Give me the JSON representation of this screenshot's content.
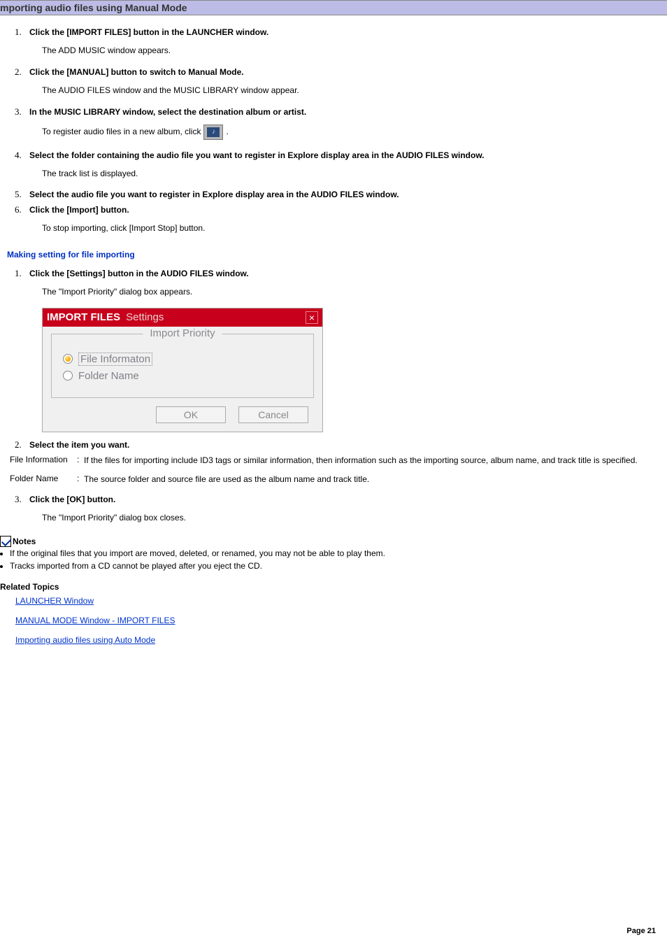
{
  "titleBar": "mporting audio files using Manual Mode",
  "steps": [
    {
      "label": "Click the [IMPORT FILES] button in the LAUNCHER window.",
      "desc": "The ADD MUSIC window appears."
    },
    {
      "label": "Click the [MANUAL] button to switch to Manual Mode.",
      "desc": "The AUDIO FILES window and the MUSIC LIBRARY window appear."
    },
    {
      "label": "In the MUSIC LIBRARY window, select the destination album or artist.",
      "descPrefix": "To register audio files in a new album, click",
      "descSuffix": "."
    },
    {
      "label": "Select the folder containing the audio file you want to register in Explore display area in the AUDIO FILES window.",
      "desc": "The track list is displayed."
    },
    {
      "label": "Select the audio file you want to register in Explore display area in the AUDIO FILES window."
    },
    {
      "label": "Click the [Import] button.",
      "desc": "To stop importing, click [Import Stop] button."
    }
  ],
  "subhead1": "Making setting for file importing",
  "subSteps": [
    {
      "label": "Click the [Settings] button in the AUDIO FILES window.",
      "desc": "The \"Import Priority\" dialog box appears."
    },
    {
      "label": "Select the item you want."
    },
    {
      "label": "Click the [OK] button.",
      "desc": "The \"Import Priority\" dialog box closes."
    }
  ],
  "dialog": {
    "title1": "IMPORT FILES",
    "title2": "Settings",
    "groupLabel": "Import Priority",
    "opt1": "File Informaton",
    "opt2": "Folder Name",
    "ok": "OK",
    "cancel": "Cancel"
  },
  "defs": {
    "t1": "File Information",
    "d1": "If the files for importing include ID3 tags or similar information, then information such as the importing source, album name, and track title is specified.",
    "t2": "Folder Name",
    "d2": "The source folder and source file are used as the album name and track title."
  },
  "notesHead": "Notes",
  "notes": [
    "If the original files that you import are moved, deleted, or renamed, you may not be able to play them.",
    "Tracks imported from a CD cannot be played after you eject the CD."
  ],
  "relatedHead": "Related Topics",
  "related": [
    "LAUNCHER Window",
    "MANUAL MODE Window - IMPORT FILES",
    "Importing audio files using Auto Mode"
  ],
  "pageNum": "Page 21"
}
